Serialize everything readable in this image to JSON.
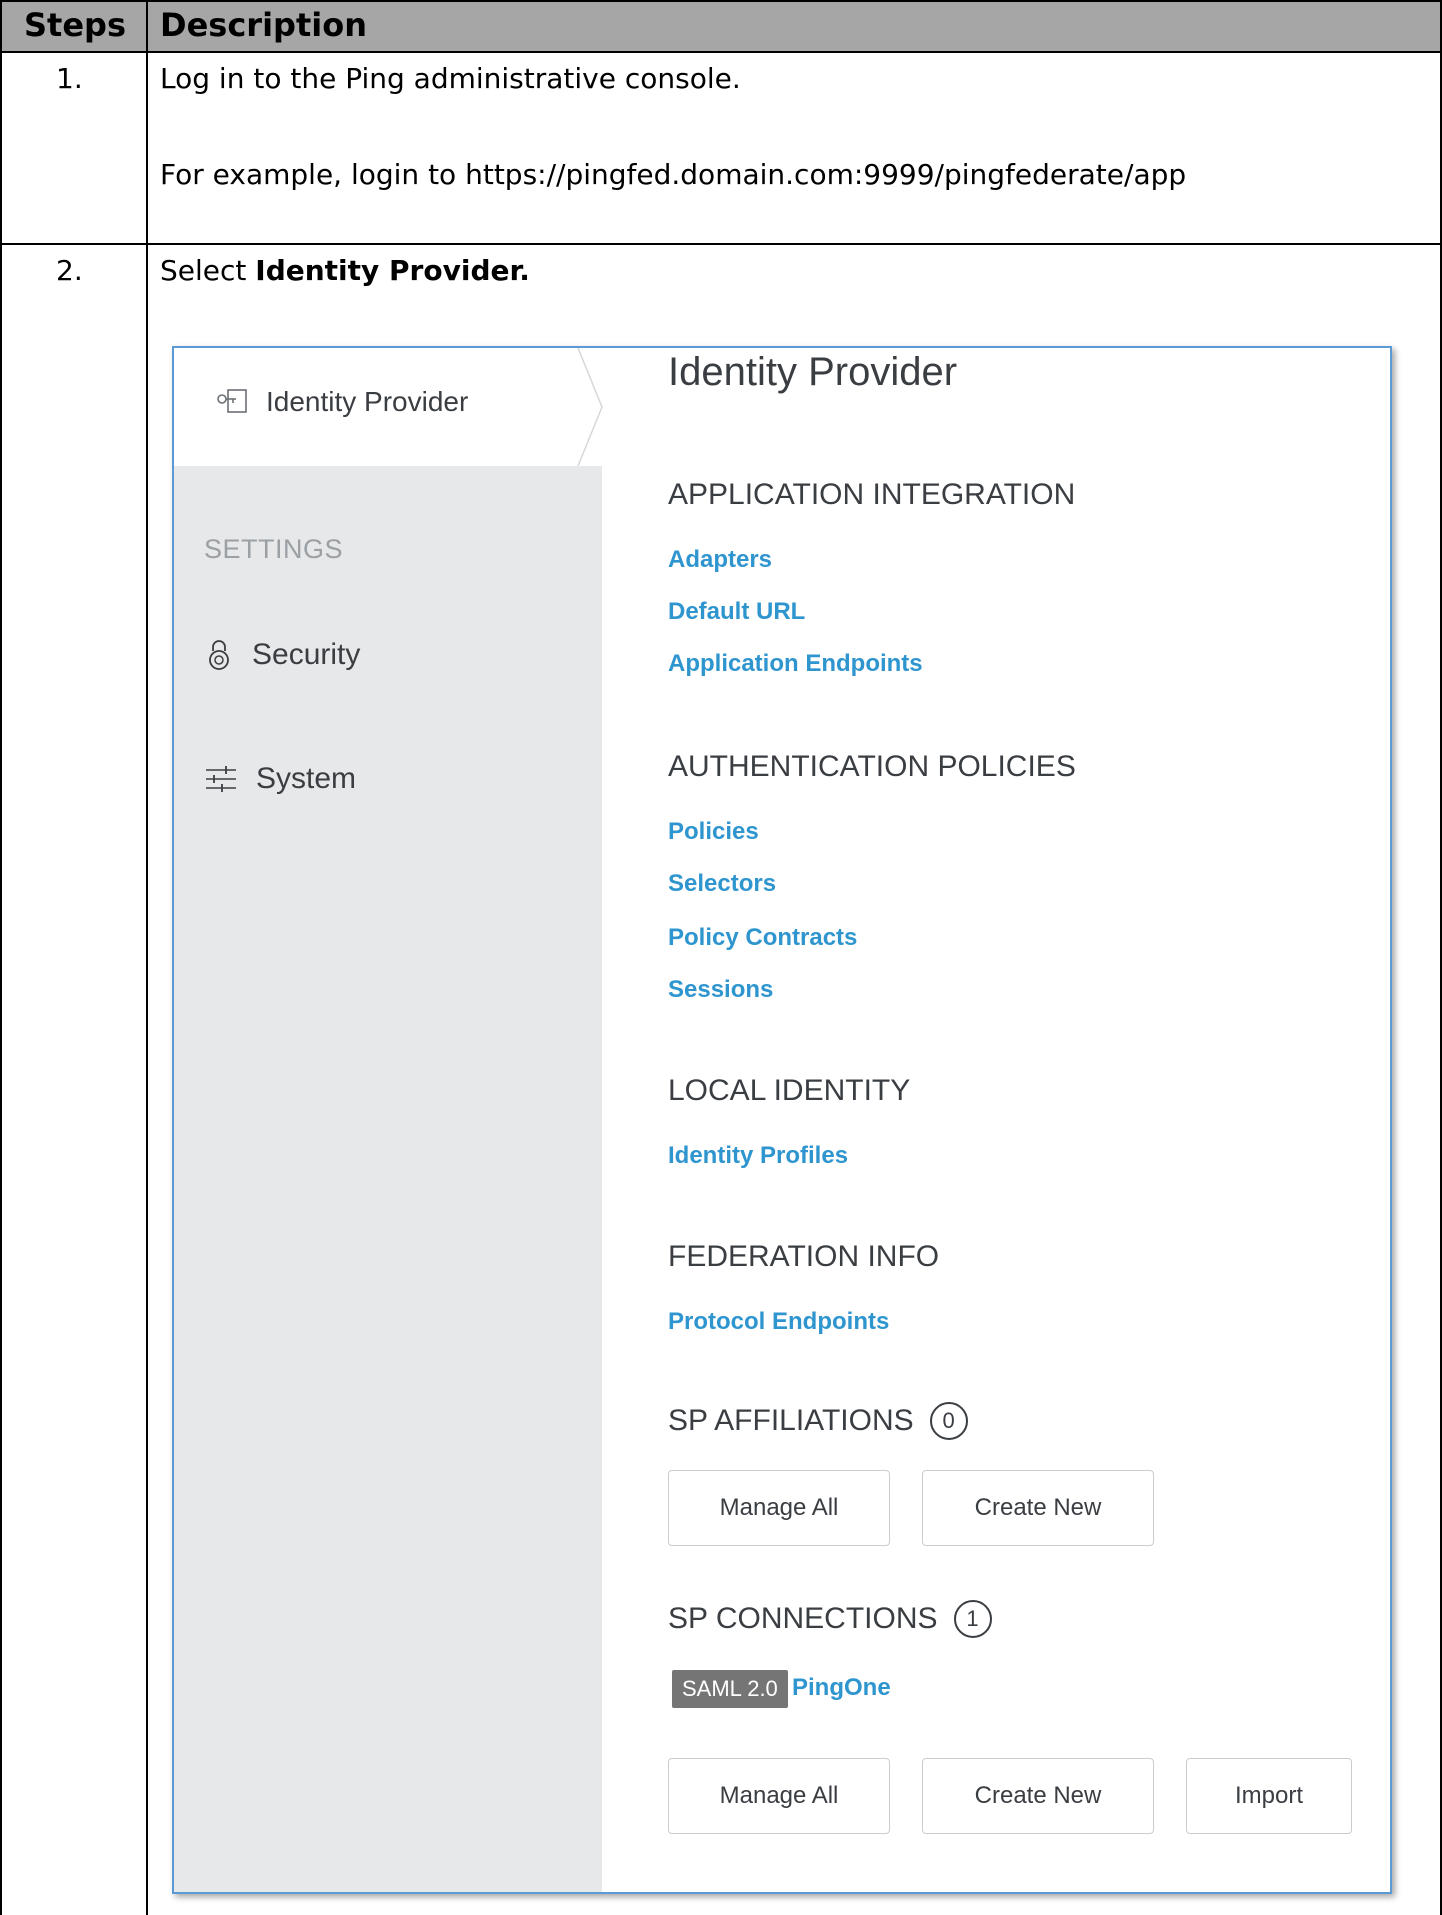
{
  "table": {
    "headers": {
      "steps": "Steps",
      "description": "Description"
    },
    "rows": [
      {
        "step": "1.",
        "line1": "Log in to the Ping administrative console.",
        "line2": "For example, login to https://pingfed.domain.com:9999/pingfederate/app"
      },
      {
        "step": "2.",
        "prefix": "Select ",
        "bold": "Identity Provider."
      }
    ]
  },
  "screenshot": {
    "sidebar": {
      "active": {
        "label": "Identity Provider",
        "icon": "identity-provider-icon"
      },
      "settings_heading": "SETTINGS",
      "items": [
        {
          "label": "Security",
          "icon": "lock-icon"
        },
        {
          "label": "System",
          "icon": "sliders-icon"
        }
      ]
    },
    "title": "Identity Provider",
    "sections": {
      "app_integration": {
        "heading": "APPLICATION INTEGRATION",
        "links": [
          "Adapters",
          "Default URL",
          "Application Endpoints"
        ]
      },
      "auth_policies": {
        "heading": "AUTHENTICATION POLICIES",
        "links": [
          "Policies",
          "Selectors",
          "Policy Contracts",
          "Sessions"
        ]
      },
      "local_identity": {
        "heading": "LOCAL IDENTITY",
        "links": [
          "Identity Profiles"
        ]
      },
      "federation_info": {
        "heading": "FEDERATION INFO",
        "links": [
          "Protocol Endpoints"
        ]
      },
      "sp_affiliations": {
        "heading": "SP AFFILIATIONS",
        "count": "0",
        "buttons": [
          "Manage All",
          "Create New"
        ]
      },
      "sp_connections": {
        "heading": "SP CONNECTIONS",
        "count": "1",
        "badge": "SAML 2.0",
        "connection": "PingOne",
        "buttons": [
          "Manage All",
          "Create New",
          "Import"
        ]
      }
    },
    "colors": {
      "link": "#2f95cf",
      "sidebar_bg": "#e6e8e9",
      "border": "#5b9bd5",
      "badge_bg": "#757575"
    }
  }
}
